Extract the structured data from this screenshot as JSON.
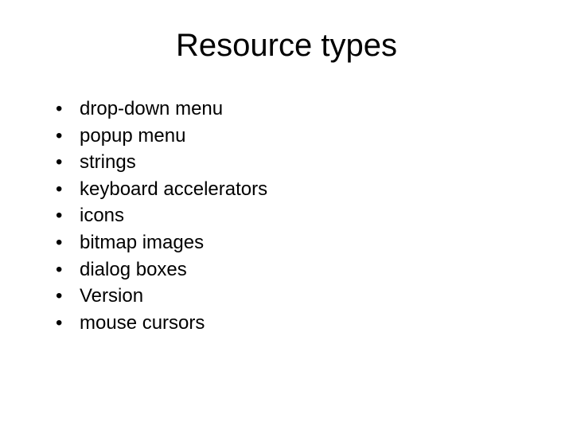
{
  "slide": {
    "title": "Resource types",
    "bullets": [
      "drop-down menu",
      "popup menu",
      "strings",
      "keyboard accelerators",
      "icons",
      "bitmap images",
      "dialog boxes",
      "Version",
      "mouse cursors"
    ]
  }
}
